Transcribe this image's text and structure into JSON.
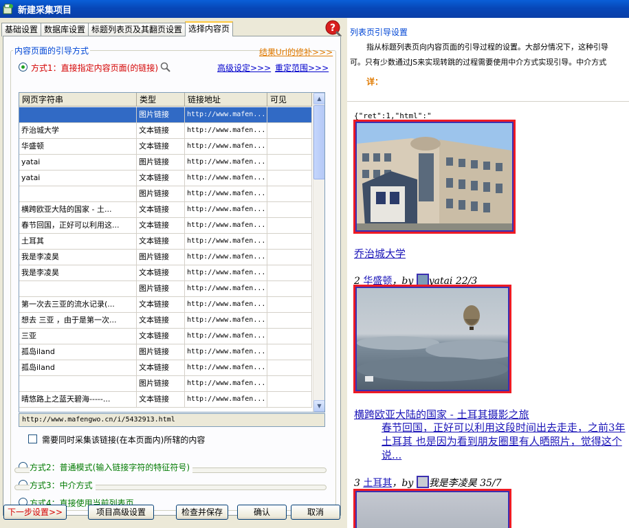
{
  "window": {
    "title": "新建采集项目"
  },
  "tabs": [
    {
      "label": "基础设置",
      "active": false
    },
    {
      "label": "数据库设置",
      "active": false
    },
    {
      "label": "标题列表页及其翻页设置",
      "active": false
    },
    {
      "label": "选择内容页",
      "active": true
    }
  ],
  "group": {
    "title": "内容页面的引导方式",
    "result_fix_link": "结果Url的修补>>>",
    "advanced_link": "高级设定>>>",
    "scope_link": "重定范围>>>"
  },
  "modes": {
    "mode1": "方式1：直接指定内容页面(的链接)",
    "mode2": "方式2：普通模式(输入链接字符的特征符号)",
    "mode3": "方式3：中介方式",
    "mode4": "方式4：直接使用当前列表页"
  },
  "table": {
    "columns": [
      "网页字符串",
      "类型",
      "链接地址",
      "可见"
    ],
    "rows": [
      [
        "",
        "图片链接",
        "http://www.mafen...",
        ""
      ],
      [
        "乔治城大学",
        "文本链接",
        "http://www.mafen...",
        ""
      ],
      [
        "华盛顿",
        "文本链接",
        "http://www.mafen...",
        ""
      ],
      [
        "yatai",
        "图片链接",
        "http://www.mafen...",
        ""
      ],
      [
        "yatai",
        "文本链接",
        "http://www.mafen...",
        ""
      ],
      [
        "",
        "图片链接",
        "http://www.mafen...",
        ""
      ],
      [
        "横跨欧亚大陆的国家 - 土...",
        "文本链接",
        "http://www.mafen...",
        ""
      ],
      [
        "春节回国，正好可以利用这...",
        "文本链接",
        "http://www.mafen...",
        ""
      ],
      [
        "土耳其",
        "文本链接",
        "http://www.mafen...",
        ""
      ],
      [
        "我是李凌昊",
        "图片链接",
        "http://www.mafen...",
        ""
      ],
      [
        "我是李凌昊",
        "文本链接",
        "http://www.mafen...",
        ""
      ],
      [
        "",
        "图片链接",
        "http://www.mafen...",
        ""
      ],
      [
        "第一次去三亚的流水记录(...",
        "文本链接",
        "http://www.mafen...",
        ""
      ],
      [
        "想去 三亚 ，由于是第一次...",
        "文本链接",
        "http://www.mafen...",
        ""
      ],
      [
        "三亚",
        "文本链接",
        "http://www.mafen...",
        ""
      ],
      [
        "孤岛iland",
        "图片链接",
        "http://www.mafen...",
        ""
      ],
      [
        "孤岛iland",
        "文本链接",
        "http://www.mafen...",
        ""
      ],
      [
        "",
        "图片链接",
        "http://www.mafen...",
        ""
      ],
      [
        "晴悠路上之蓝天碧海-----...",
        "文本链接",
        "http://www.mafen...",
        ""
      ]
    ]
  },
  "selected_url": "http://www.mafengwo.cn/i/5432913.html",
  "checkbox_label": "需要同时采集该链接(在本页面内)所辖的内容",
  "buttons": {
    "next": "下一步设置>>",
    "advanced": "项目高级设置",
    "check_save": "检查并保存",
    "ok": "确认",
    "cancel": "取消"
  },
  "info": {
    "title": "列表页引导设置",
    "line1": "指从标题列表页向内容页面的引导过程的设置。大部分情况下，这种引导",
    "line2": "可。只有少数通过JS来实现转跳的过程需要使用中介方式实现引导。中介方式",
    "detail": "详："
  },
  "preview": {
    "json_snippet": "{\"ret\":1,\"html\":\"",
    "item1_link": "乔治城大学",
    "item2_prefix": "2 ",
    "item2_city": "华盛顿",
    "item2_by": "，by",
    "item2_user": "yatai",
    "item2_count": " 22/3",
    "item3_title": "横跨欧亚大陆的国家 - 土耳其摄影之旅",
    "item3_desc1": "春节回国，正好可以利用这段时间出去走走，之前3年",
    "item3_desc2": "土耳其 也是因为看到朋友圈里有人晒照片，觉得这个",
    "item3_desc3": "说...",
    "item4_prefix": "3 ",
    "item4_city": "土耳其",
    "item4_by": "，by",
    "item4_user": "我是李凌昊",
    "item4_count": " 35/7"
  }
}
